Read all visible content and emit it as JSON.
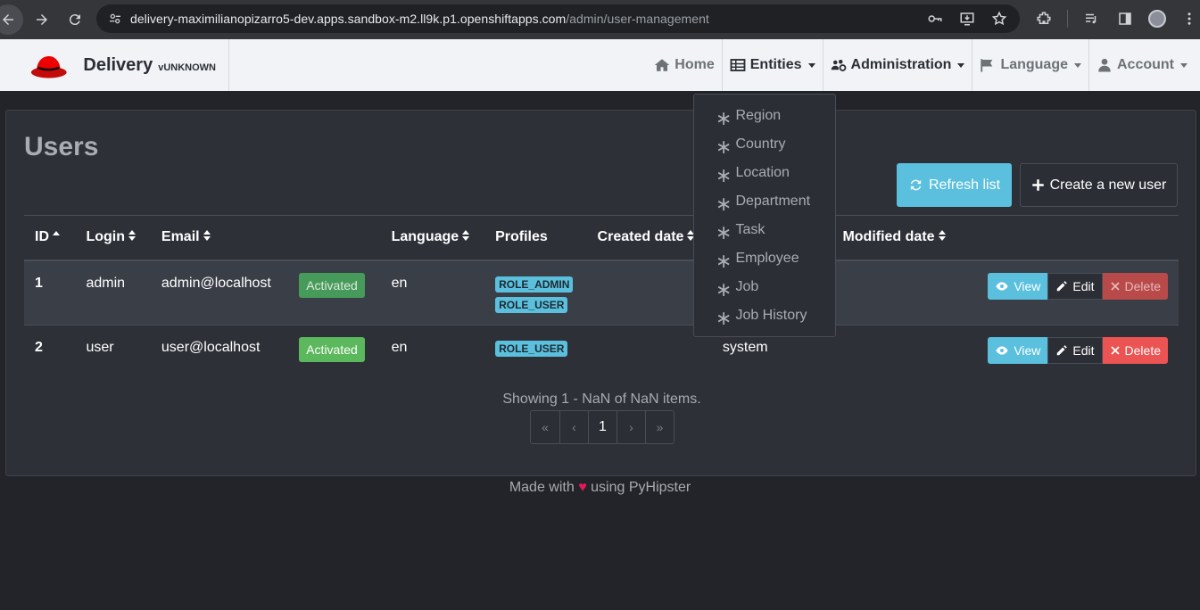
{
  "browser": {
    "url_host": "delivery-maximilianopizarro5-dev.apps.sandbox-m2.ll9k.p1.openshiftapps.com",
    "url_path": "/admin/user-management"
  },
  "navbar": {
    "brand_title": "Delivery",
    "brand_version": "vUNKNOWN",
    "items": [
      {
        "label": "Home",
        "icon": "home-icon"
      },
      {
        "label": "Entities",
        "icon": "table-icon"
      },
      {
        "label": "Administration",
        "icon": "users-cog-icon"
      },
      {
        "label": "Language",
        "icon": "flag-icon"
      },
      {
        "label": "Account",
        "icon": "user-icon"
      }
    ]
  },
  "entities_menu": [
    "Region",
    "Country",
    "Location",
    "Department",
    "Task",
    "Employee",
    "Job",
    "Job History"
  ],
  "page": {
    "title": "Users",
    "refresh_label": "Refresh list",
    "create_label": "Create a new user"
  },
  "table": {
    "headers": [
      "ID",
      "Login",
      "Email",
      "",
      "Language",
      "Profiles",
      "Created date",
      "",
      "Modified date",
      ""
    ],
    "rows": [
      {
        "id": "1",
        "login": "admin",
        "email": "admin@localhost",
        "status": "Activated",
        "language": "en",
        "roles": [
          "ROLE_ADMIN",
          "ROLE_USER"
        ],
        "created_by": ""
      },
      {
        "id": "2",
        "login": "user",
        "email": "user@localhost",
        "status": "Activated",
        "language": "en",
        "roles": [
          "ROLE_USER"
        ],
        "created_by": "system"
      }
    ],
    "view_label": "View",
    "edit_label": "Edit",
    "delete_label": "Delete"
  },
  "pagination": {
    "summary": "Showing 1 - NaN of NaN items.",
    "first": "«",
    "prev": "‹",
    "current": "1",
    "next": "›",
    "last": "»"
  },
  "footer": {
    "prefix": "Made with",
    "heart": "♥",
    "suffix": "using PyHipster"
  },
  "colors": {
    "info": "#5bc0de",
    "success": "#5cb85c",
    "danger": "#ec5353",
    "heart": "#e8175d"
  }
}
